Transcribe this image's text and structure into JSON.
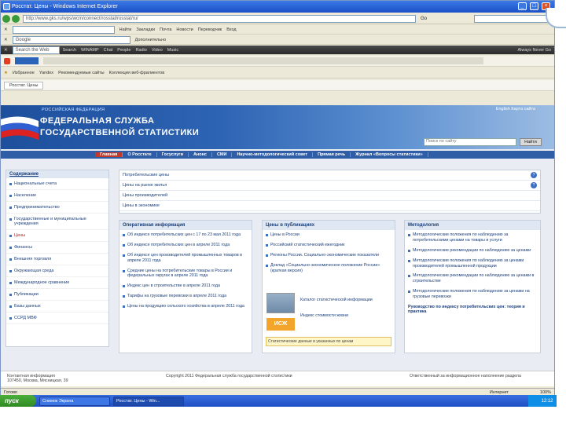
{
  "window": {
    "title": "Росстат. Цены - Windows Internet Explorer",
    "min": "_",
    "max": "□",
    "close": "×"
  },
  "address": {
    "url": "http://www.gks.ru/wps/wcm/connect/rosstat/rosstat/ru/",
    "go": "Go"
  },
  "toolbar1": {
    "items": [
      "Найти",
      "Закладки",
      "Почта",
      "Новости",
      "Переводчик",
      "Вход"
    ]
  },
  "toolbar2": {
    "search_placeholder": "Google",
    "items": [
      "Дополнительно"
    ]
  },
  "toolbar3": {
    "items": [
      "Search the Web",
      "Search",
      "WINAMP",
      "Chat",
      "People",
      "Radio",
      "Video",
      "Music",
      "Always Never Go"
    ]
  },
  "favbar": {
    "items": [
      "Избранное",
      "Yandex",
      "Рекомендуемые сайты",
      "Коллекция веб-фрагментов"
    ]
  },
  "tab": {
    "label": "Росстат. Цены"
  },
  "header": {
    "sub": "РОССИЙСКАЯ ФЕДЕРАЦИЯ",
    "title1": "ФЕДЕРАЛЬНАЯ СЛУЖБА",
    "title2": "ГОСУДАРСТВЕННОЙ СТАТИСТИКИ",
    "lang": "English   Карта сайта",
    "search_placeholder": "Поиск по сайту",
    "search_button": "Найти"
  },
  "menu": [
    "Главная",
    "О Росстате",
    "Госуслуги",
    "Анонс",
    "СМИ",
    "Научно-методологический совет",
    "Прямая речь",
    "Журнал «Вопросы статистики»"
  ],
  "sidebar": {
    "head": "Содержание",
    "items": [
      "Национальные счета",
      "Население",
      "Предпринимательство",
      "Государственные и муниципальные учреждения",
      "Цены",
      "Финансы",
      "Внешняя торговля",
      "Окружающая среда",
      "Международное сравнение",
      "Публикации",
      "Базы данных",
      "ССРД МВФ"
    ]
  },
  "links": [
    "Потребительские цены",
    "Цены на рынке жилья",
    "Цены производителей",
    "Цены в экономике"
  ],
  "operative": {
    "head": "Оперативная информация",
    "items": [
      "Об индексе потребительских цен с 17 по 23 мая 2011 года",
      "Об индексе потребительских цен в апреле 2011 года",
      "Об индексе цен производителей промышленных товаров в апреле 2011 года",
      "Средние цены на потребительские товары в России и федеральных округах в апреле 2011 года",
      "Индекс цен в строительстве в апреле 2011 года",
      "Тарифы на грузовые перевозки в апреле 2011 года",
      "Цены на продукцию сельского хозяйства в апреле 2011 года"
    ]
  },
  "pubs": {
    "head": "Цены в публикациях",
    "items": [
      "Цены в России",
      "Российский статистический ежегодник",
      "Регионы России. Социально-экономические показатели",
      "Доклад «Социально-экономическое положение России» (краткая версия)"
    ],
    "banner1": "Каталог статистической информации",
    "banner2": "Индекс стоимости жизни",
    "note": "Статистические данные в указанных по ценам"
  },
  "method": {
    "head": "Методология",
    "items": [
      "Методологические положения по наблюдению за потребительскими ценами на товары и услуги",
      "Методологические рекомендации по наблюдению за ценами",
      "Методологические положения по наблюдению за ценами производителей промышленной продукции",
      "Методологические рекомендации по наблюдению за ценами в строительстве",
      "Методологические положения по наблюдению за ценами на грузовые перевозки"
    ],
    "extra": "Руководство по индексу потребительских цен: теория и практика"
  },
  "footer": {
    "left": "Контактная информация\n107450, Москва, Мясницкая, 39",
    "center": "Copyright 2011 Федеральная служба государственной статистики",
    "right": "Ответственный за информационное наполнение раздела"
  },
  "status": {
    "left": "Готово",
    "zone": "Интернет",
    "zoom": "100%"
  },
  "taskbar": {
    "start": "пуск",
    "tasks": [
      "Снимок Экрана",
      "Росстат. Цены - Win..."
    ],
    "clock": "12:12"
  }
}
